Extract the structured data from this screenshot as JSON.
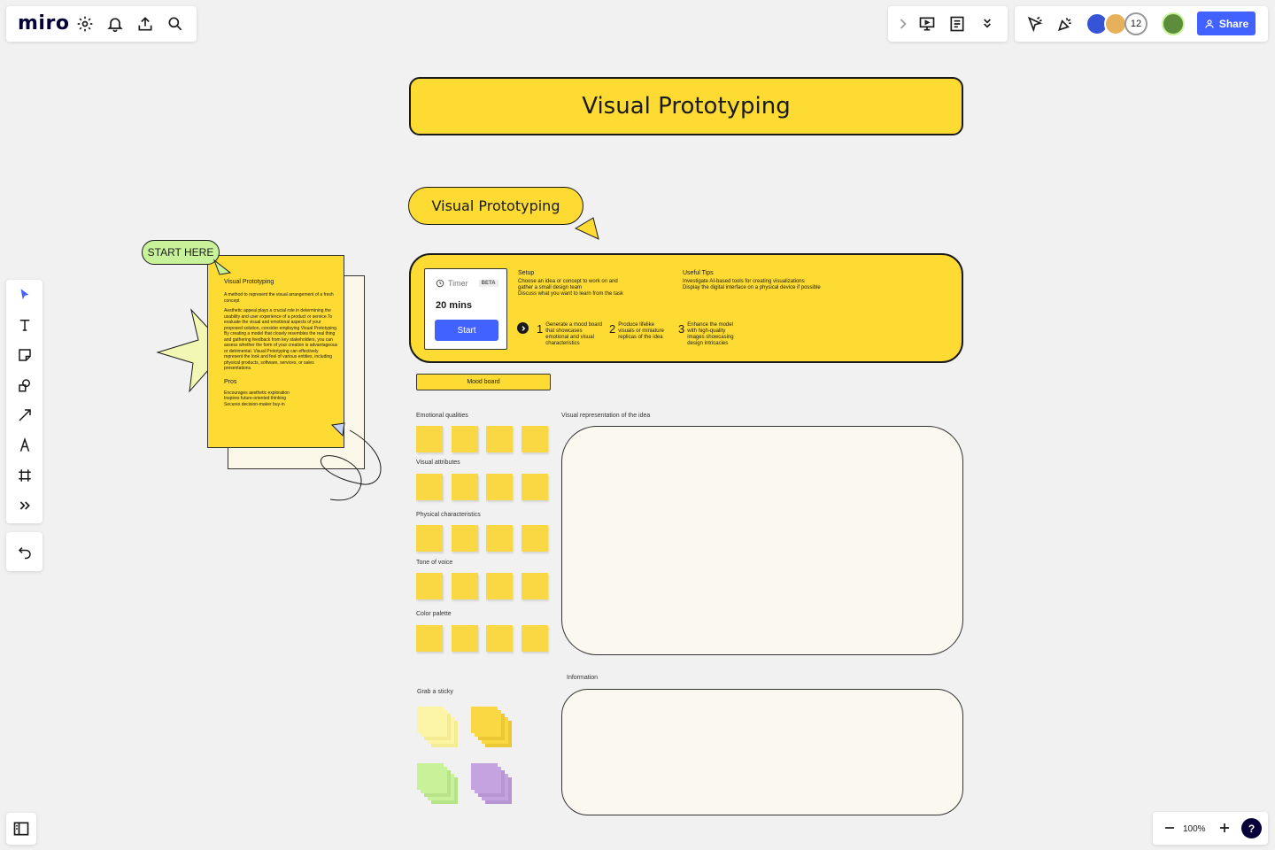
{
  "app": {
    "logo": "miro"
  },
  "topbar": {
    "share_label": "Share",
    "collaborator_count": "12"
  },
  "board": {
    "title": "Visual Prototyping",
    "subtitle_pill": "Visual Prototyping",
    "start_here": "START HERE",
    "timer": {
      "label": "Timer",
      "badge": "BETA",
      "duration": "20 mins",
      "start_label": "Start"
    },
    "setup": {
      "heading": "Setup",
      "lines": [
        "Choose an idea or concept to work on and",
        "gather a small design team",
        "Discuss what you want to learn from the task"
      ]
    },
    "tips": {
      "heading": "Useful Tips",
      "lines": [
        "Investigate AI-based tools for creating visualizations",
        "Display the digital interface on a physical device if possible"
      ]
    },
    "steps": [
      {
        "num": "1",
        "text": "Generate a mood board that showcases emotional and visual characteristics"
      },
      {
        "num": "2",
        "text": "Produce lifelike visuals or miniature replicas of the idea"
      },
      {
        "num": "3",
        "text": "Enhance the model with high-quality images showcasing design intricacies"
      }
    ],
    "mood_board_button": "Mood board",
    "rows": [
      {
        "label": "Emotional qualities"
      },
      {
        "label": "Visual attributes"
      },
      {
        "label": "Physical characteristics"
      },
      {
        "label": "Tone of voice"
      },
      {
        "label": "Color palette"
      }
    ],
    "visual_rep_label": "Visual representation of the idea",
    "information_label": "Information",
    "grab_sticky_label": "Grab a sticky",
    "sticky_colors": [
      "#fdf5a6",
      "#f9d843",
      "#c8f29a",
      "#c5a3e0"
    ],
    "doc": {
      "title": "Visual Prototyping",
      "intro": "A method to represent the visual arrangement of a fresh concept",
      "body": "Aesthetic appeal plays a crucial role in determining the usability and user experience of a product or service.To evaluate the visual and emotional aspects of your proposed solution, consider employing Visual Prototyping. By creating a model that closely resembles the real thing and gathering feedback from key stakeholders, you can assess whether the form of your creation is advantageous or detrimental. Visual Prototyping can effectively represent the look and feel of various entities, including physical products, software, services, or sales presentations.",
      "pros_heading": "Pros",
      "pros": [
        "Encourages aesthetic exploration",
        "Inspires future-oriented thinking",
        "Secures decision-maker buy-in"
      ]
    }
  },
  "zoom": {
    "level": "100%",
    "help": "?"
  },
  "colors": {
    "accent": "#4262ff",
    "yellow": "#fddb33",
    "sticky": "#f9d843",
    "cream": "#faf8ef",
    "green": "#c8f29a"
  }
}
